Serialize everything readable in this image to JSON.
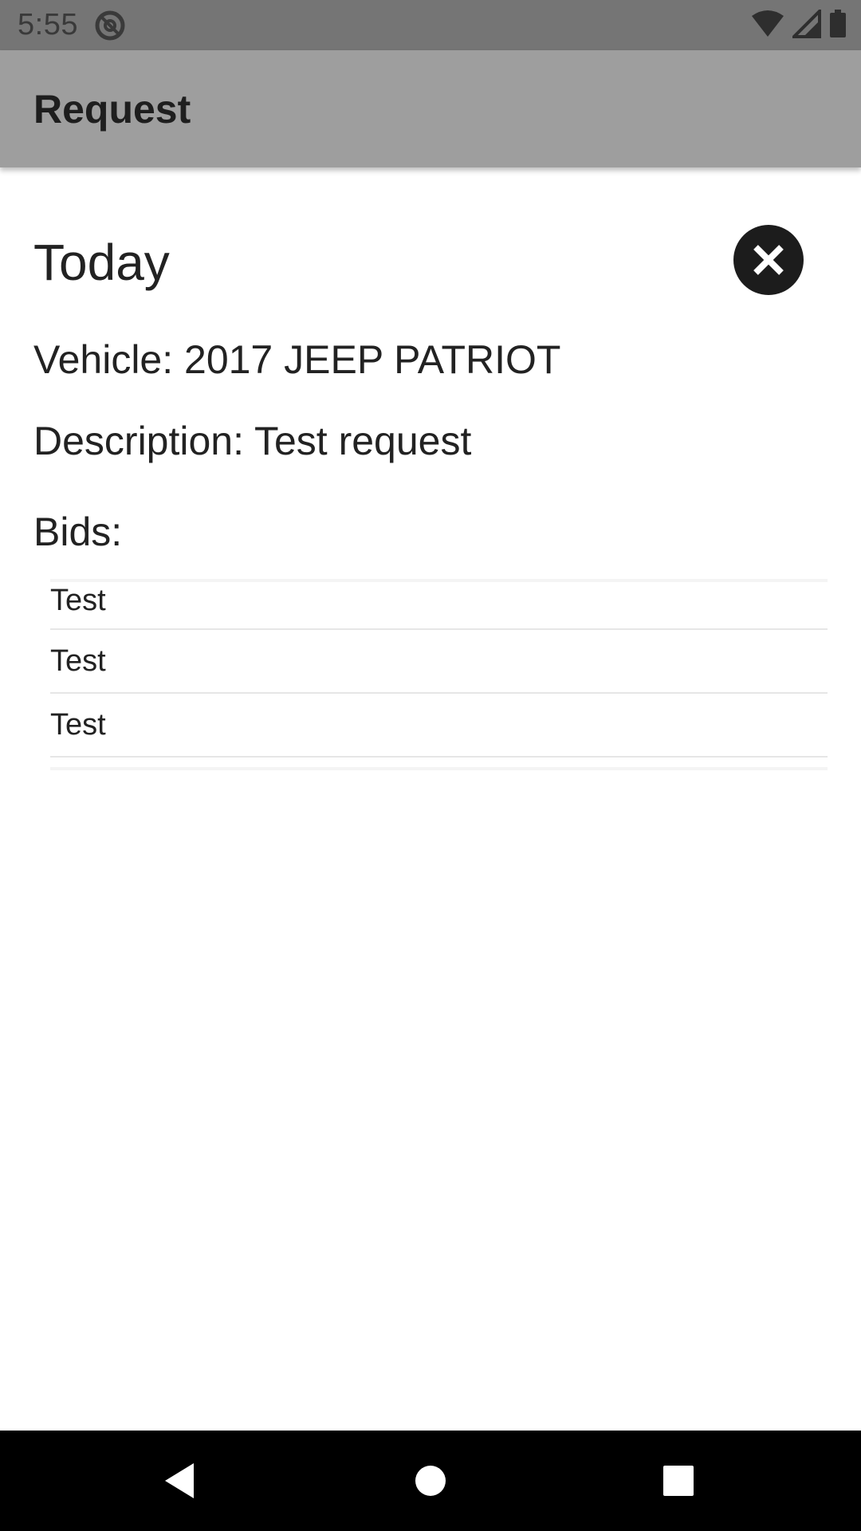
{
  "status_bar": {
    "time": "5:55",
    "icons": [
      "at-sign-icon",
      "wifi-icon",
      "signal-icon",
      "battery-icon"
    ]
  },
  "app_bar": {
    "title": "Request"
  },
  "request": {
    "date_title": "Today",
    "vehicle": "Vehicle: 2017 JEEP PATRIOT",
    "description": "Description: Test request",
    "bids_label": "Bids:",
    "bids": [
      {
        "label": "Test"
      },
      {
        "label": "Test"
      },
      {
        "label": "Test"
      }
    ],
    "close_icon": "close-icon"
  },
  "nav_bar": {
    "icons": [
      "back-icon",
      "home-icon",
      "recents-icon"
    ]
  },
  "colors": {
    "status_bar": "#757575",
    "app_bar": "#9e9e9e",
    "close_button": "#1c1c1c",
    "nav_bar": "#000000"
  }
}
